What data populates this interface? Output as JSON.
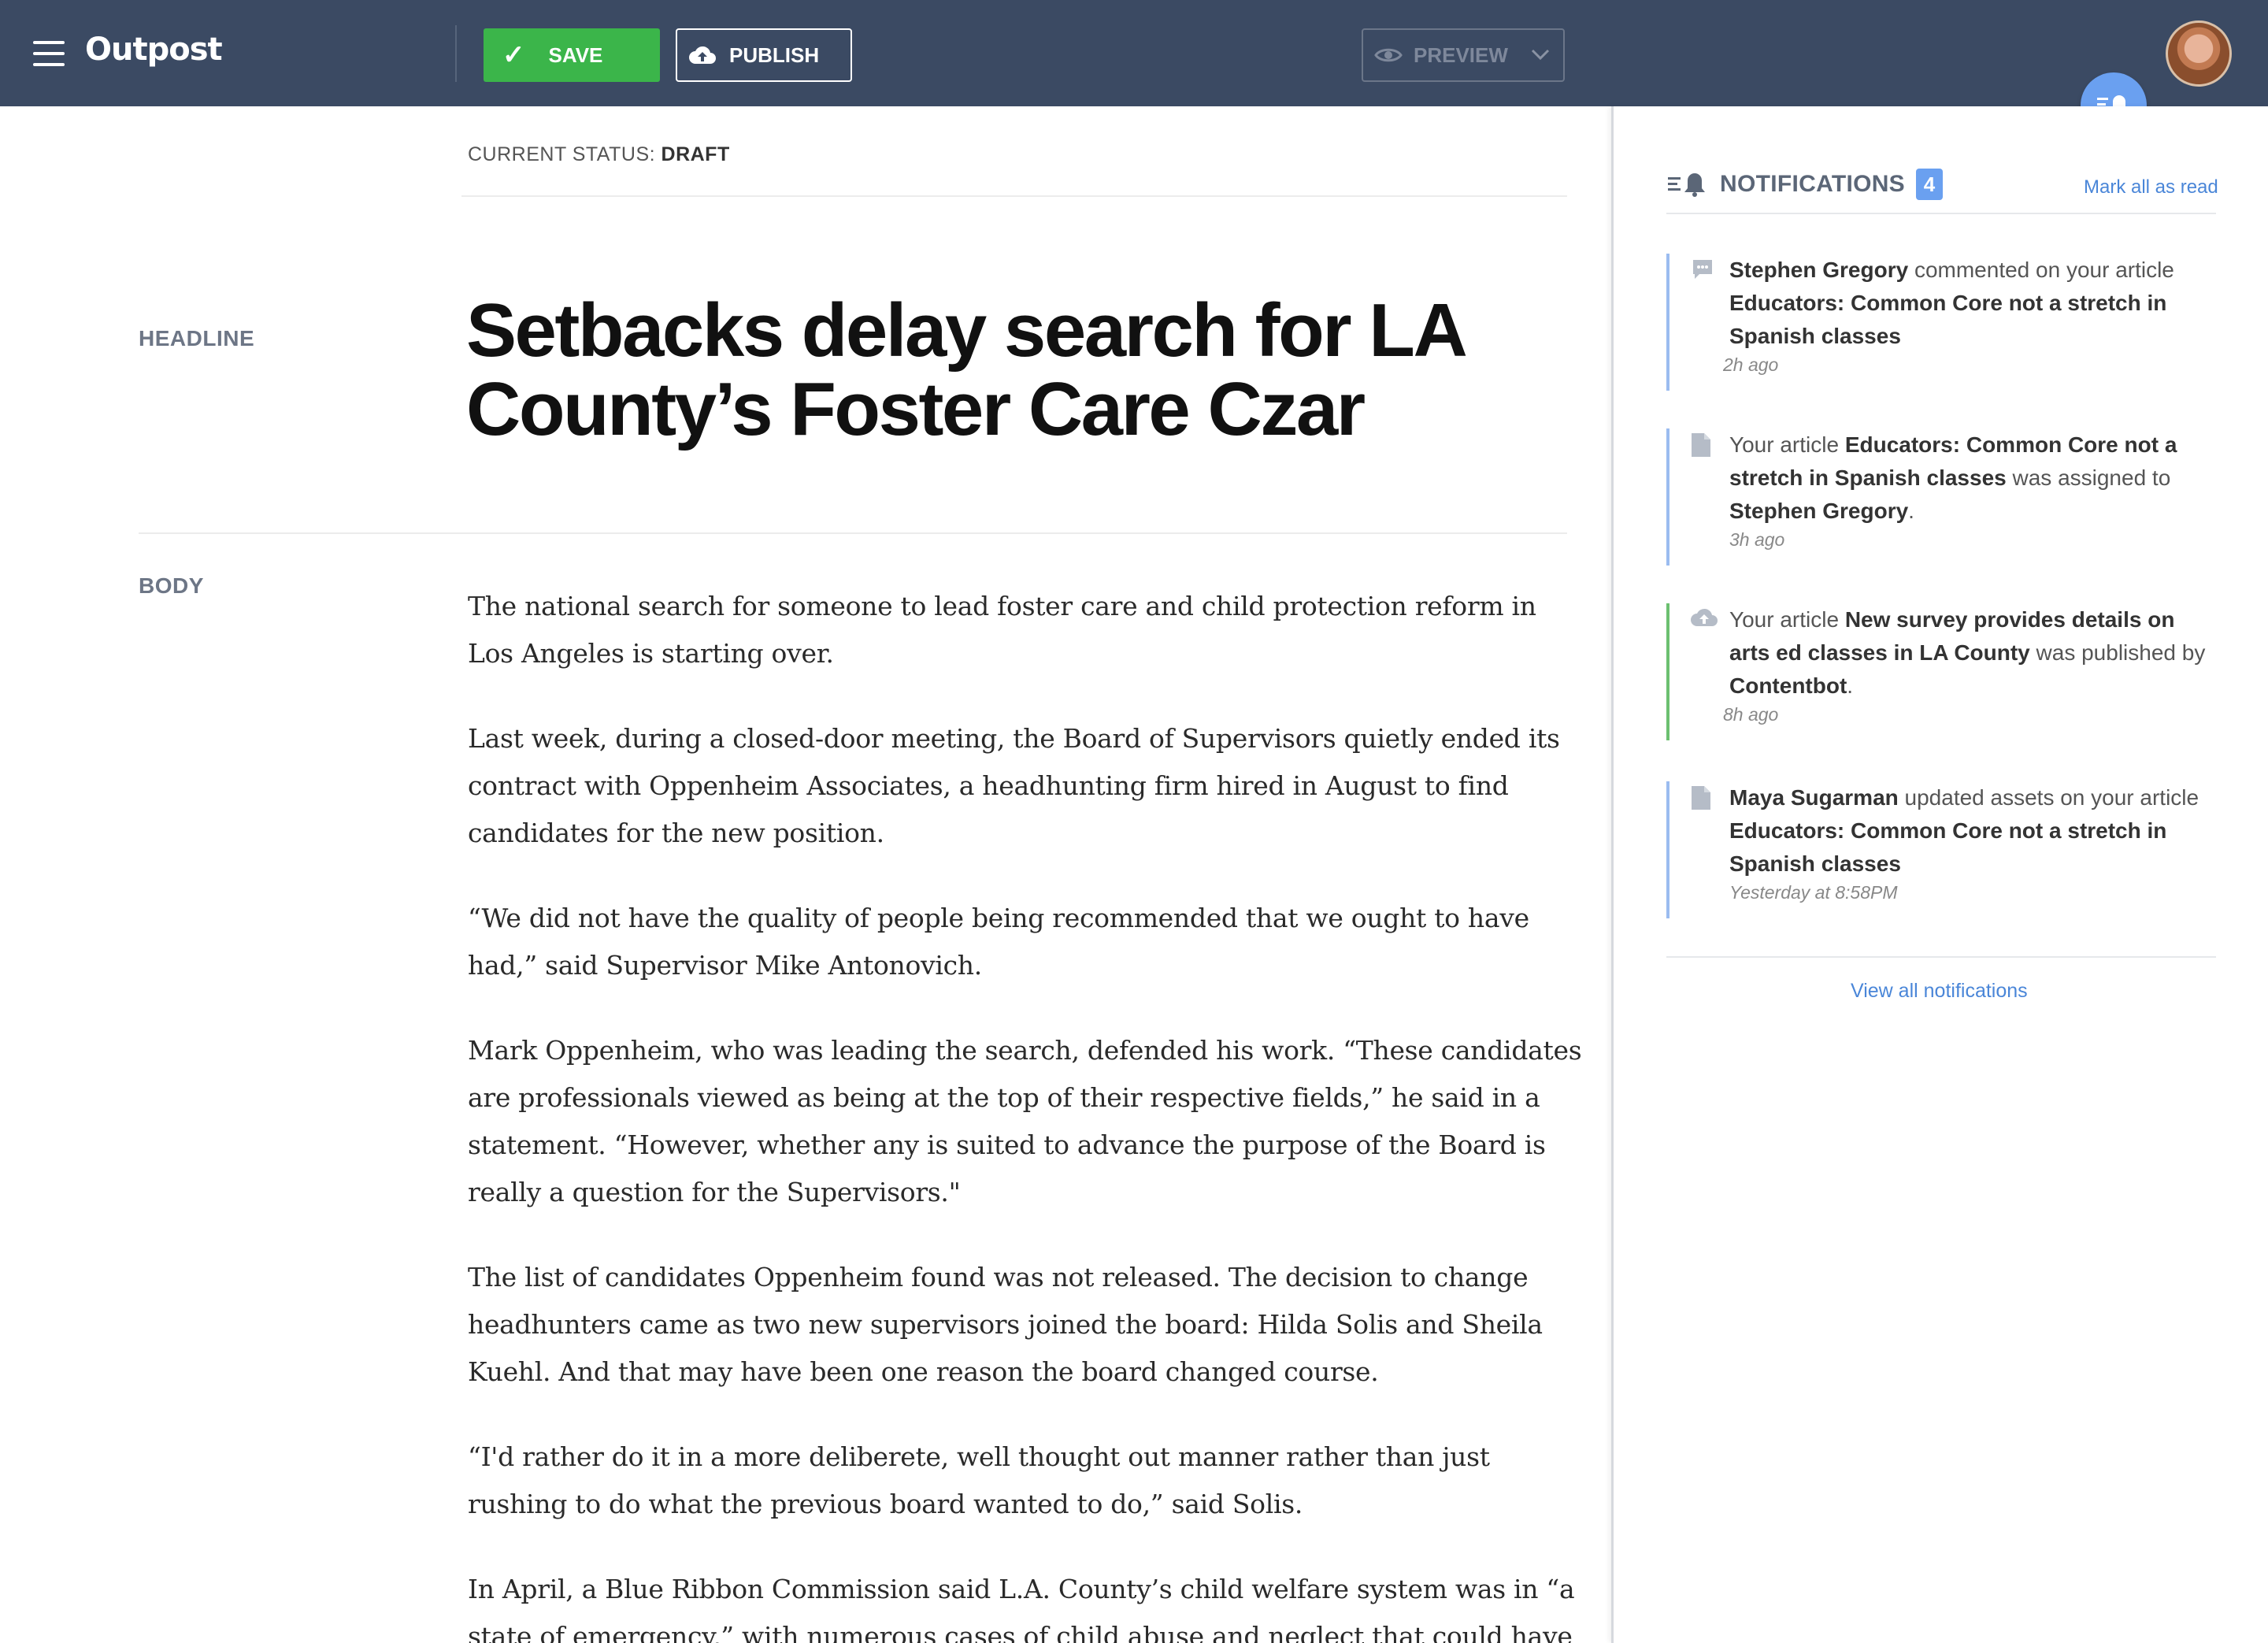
{
  "app": {
    "logo": "Outpost"
  },
  "toolbar": {
    "save_label": "SAVE",
    "publish_label": "PUBLISH",
    "preview_label": "PREVIEW"
  },
  "status": {
    "prefix": "CURRENT STATUS: ",
    "value": "DRAFT"
  },
  "editor": {
    "headline_label": "HEADLINE",
    "headline": "Setbacks delay search for LA County’s Foster Care Czar",
    "body_label": "BODY",
    "paragraphs": [
      "The national search for someone to lead foster care and child protection reform in Los Angeles is starting over.",
      "Last week, during a closed-door meeting, the Board of Supervisors quietly ended its contract with Oppenheim Associates, a headhunting firm hired in August to find candidates for the new position.",
      "“We did not have the quality of people being recommended that we ought to have had,” said Supervisor Mike Antonovich.",
      "Mark Oppenheim, who was leading the search, defended his work. “These candidates are professionals viewed as being at the top of their respective fields,” he said in a statement. “However, whether any is suited to advance the purpose of the Board is really a question for the Supervisors.\"",
      "The list of candidates Oppenheim found was not released. The decision to change headhunters came as two new supervisors joined the board: Hilda Solis and Sheila Kuehl. And that may have been one reason the board changed course.",
      "“I'd rather do it in a more deliberete, well thought out manner rather than just rushing to do what the previous board wanted to do,” said Solis.",
      "In April, a Blue Ribbon Commission said L.A. County’s child welfare system was in “a state of emergency,” with numerous cases of child abuse and neglect that could have"
    ]
  },
  "notifications": {
    "title": "NOTIFICATIONS",
    "count": "4",
    "mark_all": "Mark all as read",
    "view_all": "View all notifications",
    "items": [
      {
        "icon": "comment-icon",
        "actor": "Stephen Gregory",
        "t1": " commented on your article ",
        "article": "Educators: Common Core not a stretch in Spanish classes",
        "t2": "",
        "target": "",
        "t3": "",
        "time": "2h ago"
      },
      {
        "icon": "document-icon",
        "actor": "",
        "t1": "Your article ",
        "article": "Educators: Common Core not a stretch in Spanish classes",
        "t2": " was assigned to ",
        "target": "Stephen Gregory",
        "t3": ".",
        "time": "3h ago"
      },
      {
        "icon": "cloud-upload-icon",
        "actor": "",
        "t1": "Your article ",
        "article": "New survey provides details on arts ed classes in LA County",
        "t2": " was published by ",
        "target": "Contentbot",
        "t3": ".",
        "time": "8h ago"
      },
      {
        "icon": "document-icon",
        "actor": "Maya Sugarman",
        "t1": " updated assets on your article ",
        "article": "Educators: Common Core not a stretch in Spanish classes",
        "t2": "",
        "target": "",
        "t3": "",
        "time": "Yesterday at 8:58PM"
      }
    ]
  },
  "colors": {
    "topbar": "#3b4a63",
    "save": "#3bb54a",
    "accent": "#6aa0f0",
    "link": "#4a86d8",
    "published": "#6cc070"
  }
}
